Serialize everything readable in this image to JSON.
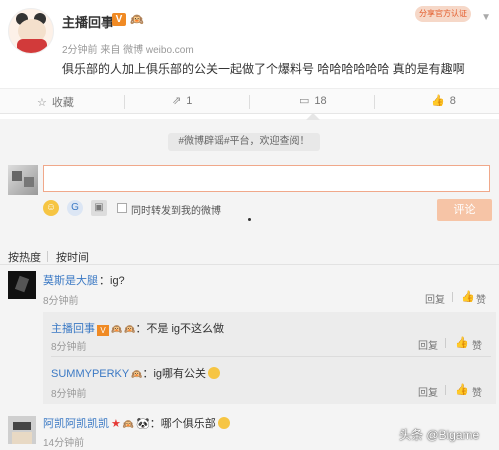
{
  "post": {
    "username": "主播回事",
    "verified_badge": "V",
    "level_badge": "🙉",
    "meta": "2分钟前 来自 微博 weibo.com",
    "text": "俱乐部的人加上俱乐部的公关一起做了个爆料号 哈哈哈哈哈哈 真的是有趣啊",
    "corner_badge": "分享官方认证",
    "menu_icon": "chevron-down-icon"
  },
  "actions": {
    "favorite_label": "收藏",
    "share_count": "1",
    "comment_count": "18",
    "like_count": "8"
  },
  "comment_box": {
    "notice": "#微博辟谣#平台，欢迎查阅！",
    "input_value": "",
    "repost_label": "同时转发到我的微博",
    "submit_label": "评论"
  },
  "sort": {
    "by_hot": "按热度",
    "by_time": "按时间"
  },
  "comments": [
    {
      "name": "莫斯是大腿",
      "text": "：ig?",
      "time": "8分钟前",
      "reply": "回复",
      "replies": [
        {
          "name": "主播回事",
          "text": "：不是 ig不这么做",
          "time": "8分钟前",
          "reply": "回复"
        },
        {
          "name": "SUMMYPERKY",
          "text": "：ig哪有公关",
          "time": "8分钟前",
          "reply": "回复"
        }
      ]
    },
    {
      "name": "阿凯阿凯凯凯",
      "text": "：哪个俱乐部",
      "time": "14分钟前",
      "reply": "回复"
    }
  ],
  "watermark": "头条 @Bigame",
  "colors": {
    "link": "#3b79c4",
    "accent": "#f6c4a6",
    "badge": "#f08a24"
  }
}
